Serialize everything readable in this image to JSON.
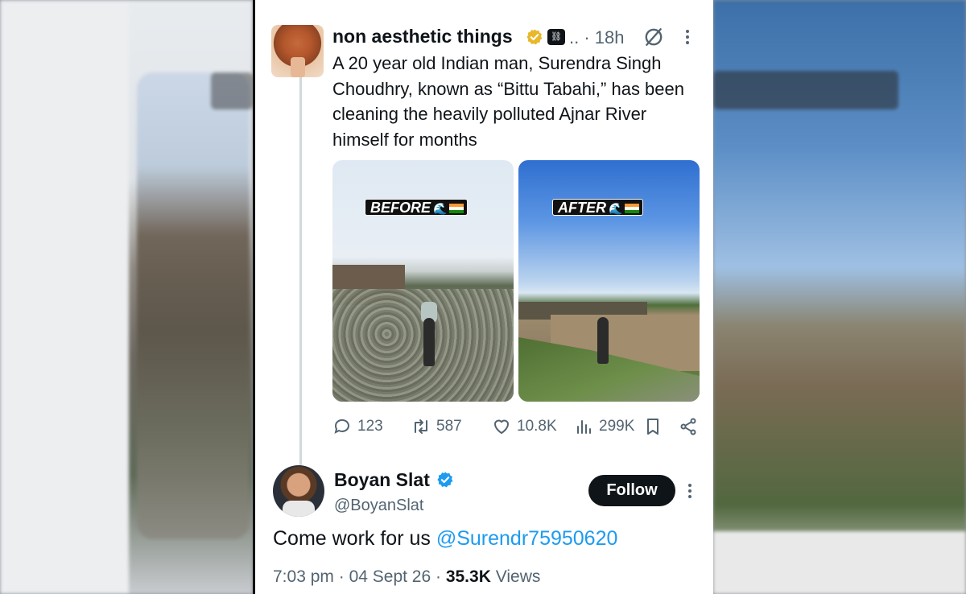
{
  "tweet": {
    "author_name": "non aesthetic things",
    "time": "18h",
    "text": "A 20 year old Indian man, Surendra Singh Choudhry, known as “Bittu Tabahi,” has been cleaning the heavily polluted Ajnar River himself for months",
    "media": [
      {
        "label": "BEFORE",
        "emoji": "🌊"
      },
      {
        "label": "AFTER",
        "emoji": "🌊"
      }
    ],
    "stats": {
      "replies": "123",
      "reposts": "587",
      "likes": "10.8K",
      "views": "299K"
    }
  },
  "reply": {
    "author_name": "Boyan Slat",
    "handle": "@BoyanSlat",
    "follow_label": "Follow",
    "text": "Come work for us",
    "mention": "@Surendr75950620",
    "time": "7:03 pm",
    "date": "04 Sept 26",
    "views_count": "35.3K",
    "views_label": "Views"
  },
  "colors": {
    "verified_gold": "#e8b829",
    "verified_blue": "#1d9bf0",
    "mention": "#1d9bf0",
    "secondary_text": "#536471"
  },
  "icons": [
    "verified-gold-icon",
    "affiliate-badge-icon",
    "grok-icon",
    "more-icon",
    "reply-icon",
    "repost-icon",
    "like-icon",
    "views-icon",
    "bookmark-icon",
    "share-icon",
    "verified-blue-icon"
  ]
}
